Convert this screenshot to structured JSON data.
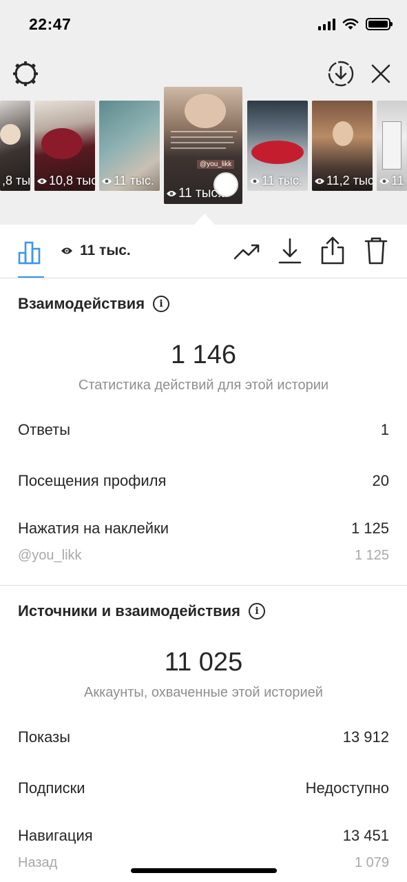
{
  "status_bar": {
    "time": "22:47"
  },
  "carousel": {
    "items": [
      {
        "views": ",8 тыс"
      },
      {
        "views": "10,8 тыс"
      },
      {
        "views": "11 тыс."
      },
      {
        "views": "11 тыс..",
        "selected": true,
        "mention": "@you_likk"
      },
      {
        "views": "11 тыс."
      },
      {
        "views": "11,2 тыс"
      },
      {
        "views": "11"
      }
    ]
  },
  "toolbar": {
    "views": "11 тыс."
  },
  "interactions": {
    "title": "Взаимодействия",
    "total": "1 146",
    "subtitle": "Статистика действий для этой истории",
    "rows": [
      {
        "label": "Ответы",
        "value": "1"
      },
      {
        "label": "Посещения профиля",
        "value": "20"
      },
      {
        "label": "Нажатия на наклейки",
        "value": "1 125"
      }
    ],
    "sticker": {
      "label": "@you_likk",
      "value": "1 125"
    }
  },
  "discovery": {
    "title": "Источники и взаимодействия",
    "total": "11 025",
    "subtitle": "Аккаунты, охваченные этой историей",
    "rows": [
      {
        "label": "Показы",
        "value": "13 912"
      },
      {
        "label": "Подписки",
        "value": "Недоступно"
      },
      {
        "label": "Навигация",
        "value": "13 451"
      }
    ],
    "nav_sub": {
      "label": "Назад",
      "value": "1 079"
    }
  },
  "colors": {
    "accent": "#3897f0",
    "muted": "#8e8e8e",
    "text": "#262626",
    "top_bg": "#efefef"
  }
}
